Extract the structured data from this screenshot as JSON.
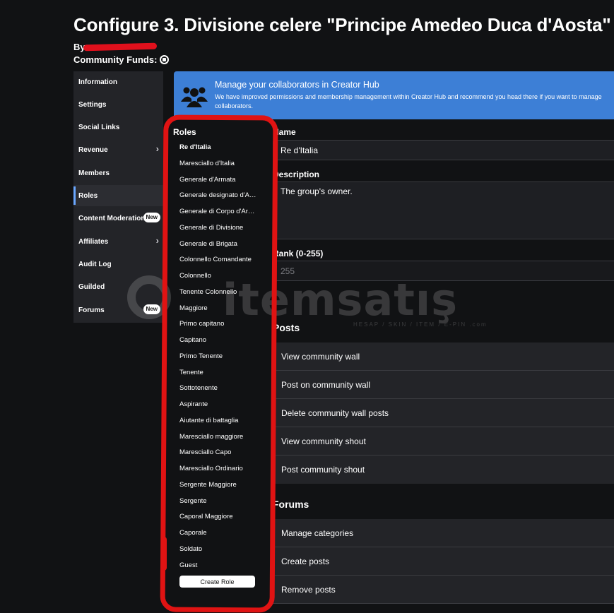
{
  "header": {
    "title": "Configure 3. Divisione celere \"Principe Amedeo Duca d'Aosta\"",
    "by_label": "By",
    "funds_label": "Community Funds:",
    "funds_icon": "robux-icon"
  },
  "nav": {
    "items": [
      {
        "label": "Information"
      },
      {
        "label": "Settings"
      },
      {
        "label": "Social Links"
      },
      {
        "label": "Revenue",
        "chevron": true
      },
      {
        "label": "Members"
      },
      {
        "label": "Roles",
        "active": true
      },
      {
        "label": "Content Moderation",
        "badge": "New"
      },
      {
        "label": "Affiliates",
        "chevron": true
      },
      {
        "label": "Audit Log"
      },
      {
        "label": "Guilded"
      },
      {
        "label": "Forums",
        "badge": "New"
      }
    ]
  },
  "roles": {
    "title": "Roles",
    "items": [
      "Re d'Italia",
      "Maresciallo d'Italia",
      "Generale d'Armata",
      "Generale designato d'Armata",
      "Generale di Corpo d'Armata",
      "Generale di Divisione",
      "Generale di Brigata",
      "Colonnello Comandante",
      "Colonnello",
      "Tenente Colonnello",
      "Maggiore",
      "Primo capitano",
      "Capitano",
      "Primo Tenente",
      "Tenente",
      "Sottotenente",
      "Aspirante",
      "Aiutante di battaglia",
      "Maresciallo maggiore",
      "Maresciallo Capo",
      "Maresciallo Ordinario",
      "Sergente Maggiore",
      "Sergente",
      "Caporal Maggiore",
      "Caporale",
      "Soldato",
      "Guest"
    ],
    "selected": "Re d'Italia",
    "create_label": "Create Role"
  },
  "banner": {
    "title": "Manage your collaborators in Creator Hub",
    "text": "We have improved permissions and membership management within Creator Hub and recommend you head there if you want to manage collaborators.",
    "icon": "collaborators-icon",
    "color": "#3d7fd6"
  },
  "form": {
    "name_label": "Name",
    "name_value": "Re d'Italia",
    "description_label": "Description",
    "description_value": "The group's owner.",
    "rank_label": "Rank (0-255)",
    "rank_value": "255"
  },
  "posts": {
    "title": "Posts",
    "items": [
      "View community wall",
      "Post on community wall",
      "Delete community wall posts",
      "View community shout",
      "Post community shout"
    ]
  },
  "forums": {
    "title": "Forums",
    "items": [
      "Manage categories",
      "Create posts",
      "Remove posts"
    ]
  },
  "watermark": {
    "text": "itemsatış",
    "subtext": "HESAP / SKIN / ITEM / E-PIN  .com"
  },
  "colors": {
    "background": "#111214",
    "panel": "#232428",
    "accent": "#6aa7ff",
    "annotation": "#e01313"
  }
}
